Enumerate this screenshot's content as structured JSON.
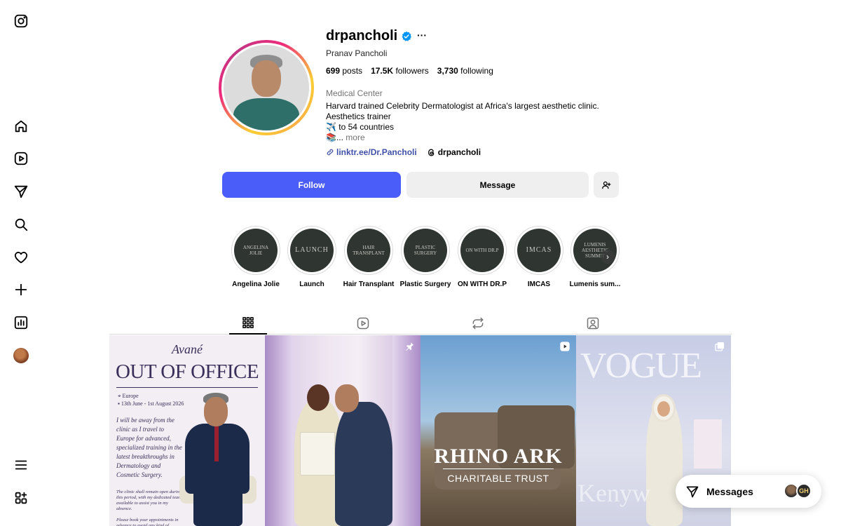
{
  "profile": {
    "username": "drpancholi",
    "full_name": "Pranav Pancholi",
    "verified": true,
    "stats": {
      "posts_count": "699",
      "posts_label": "posts",
      "followers_count": "17.5K",
      "followers_label": "followers",
      "following_count": "3,730",
      "following_label": "following"
    },
    "category": "Medical Center",
    "bio": {
      "line1": "Harvard trained Celebrity Dermatologist at Africa's largest aesthetic clinic.",
      "line2": "Aesthetics trainer",
      "line3": "✈️ to 54 countries",
      "line4_prefix": "📚... ",
      "more": "more"
    },
    "link_text": "linktr.ee/Dr.Pancholi",
    "threads_handle": "drpancholi"
  },
  "actions": {
    "follow": "Follow",
    "message": "Message"
  },
  "highlights": [
    {
      "cover": "ANGELINA JOLIE",
      "label": "Angelina Jolie"
    },
    {
      "cover": "LAUNCH",
      "label": "Launch"
    },
    {
      "cover": "HAIR TRANSPLANT",
      "label": "Hair Transplant"
    },
    {
      "cover": "PLASTIC SURGERY",
      "label": "Plastic Surgery"
    },
    {
      "cover": "ON WITH DR.P",
      "label": "ON WITH DR.P"
    },
    {
      "cover": "IMCAS",
      "label": "IMCAS"
    },
    {
      "cover": "LUMENIS AESTHETIC SUMMIT",
      "label": "Lumenis sum..."
    }
  ],
  "tabs": [
    {
      "icon": "grid-icon",
      "active": true
    },
    {
      "icon": "reels-icon",
      "active": false
    },
    {
      "icon": "reposts-icon",
      "active": false
    },
    {
      "icon": "tagged-icon",
      "active": false
    }
  ],
  "posts": {
    "p1": {
      "brand": "Avané",
      "title": "OUT OF OFFICE",
      "location": "Europe",
      "dates": "13th June - 1st August 2026",
      "body": "I will be away from the clinic as I travel to Europe for advanced, specialized training in the latest breakthroughs in Dermatology and Cosmetic Surgery.",
      "note": "The clinic shall remain open during this period, with my dedicated team available to assist you in my absence.",
      "note2": "Please book your appointments in advance to avoid any kind of disappointment."
    },
    "p2": {
      "pinned": true
    },
    "p3": {
      "title": "RHINO ARK",
      "subtitle": "CHARITABLE TRUST",
      "is_reel": true
    },
    "p4": {
      "masthead": "VOGUE",
      "overlay": "Kenyw",
      "is_carousel": true
    }
  },
  "messages_bar": {
    "label": "Messages",
    "avatar2_initials": "GH"
  },
  "colors": {
    "follow_button": "#4a5df9",
    "link": "#4150a8",
    "verified": "#0095f6"
  }
}
